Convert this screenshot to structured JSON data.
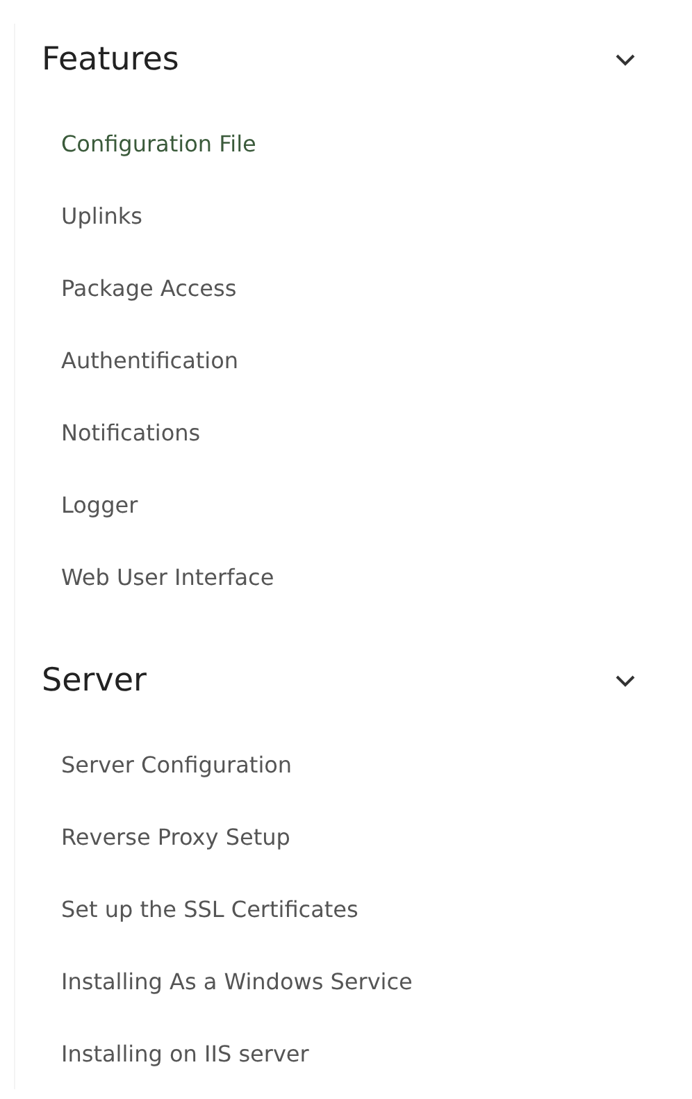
{
  "sections": [
    {
      "title": "Features",
      "expanded": true,
      "items": [
        {
          "label": "Configuration File",
          "selected": true
        },
        {
          "label": "Uplinks",
          "selected": false
        },
        {
          "label": "Package Access",
          "selected": false
        },
        {
          "label": "Authentification",
          "selected": false
        },
        {
          "label": "Notifications",
          "selected": false
        },
        {
          "label": "Logger",
          "selected": false
        },
        {
          "label": "Web User Interface",
          "selected": false
        }
      ]
    },
    {
      "title": "Server",
      "expanded": true,
      "items": [
        {
          "label": "Server Configuration",
          "selected": false
        },
        {
          "label": "Reverse Proxy Setup",
          "selected": false
        },
        {
          "label": "Set up the SSL Certificates",
          "selected": false
        },
        {
          "label": "Installing As a Windows Service",
          "selected": false
        },
        {
          "label": "Installing on IIS server",
          "selected": false
        }
      ]
    }
  ]
}
